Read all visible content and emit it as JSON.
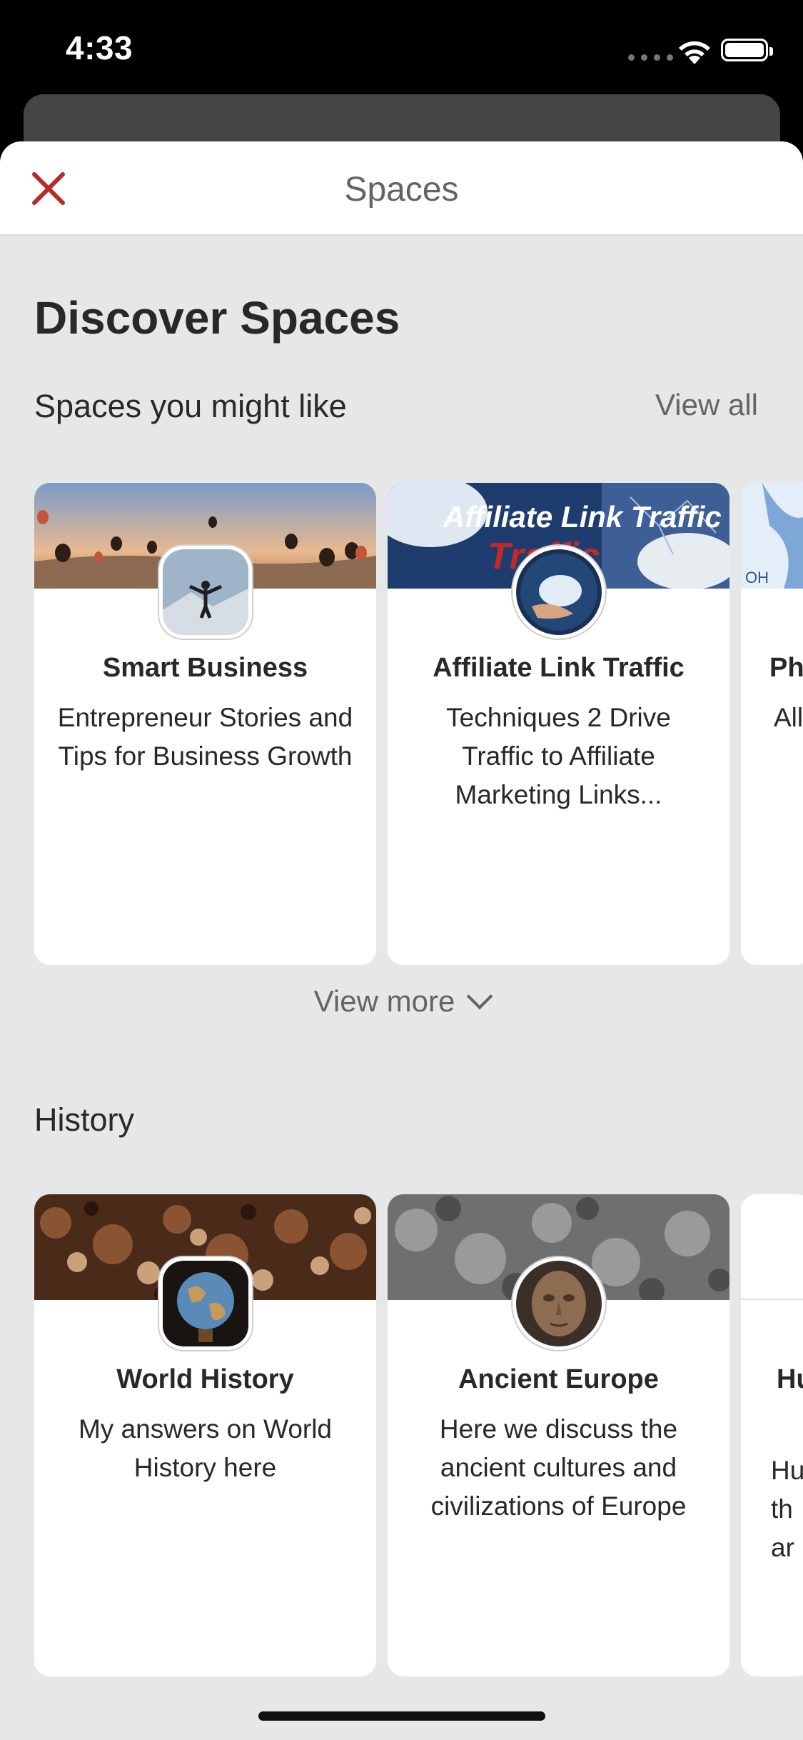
{
  "status_bar": {
    "time": "4:33"
  },
  "header": {
    "title": "Spaces"
  },
  "page": {
    "heading": "Discover Spaces"
  },
  "suggested": {
    "label": "Spaces you might like",
    "view_all": "View all",
    "cards": [
      {
        "title": "Smart Business",
        "description": "Entrepreneur Stories and Tips for Business Growth"
      },
      {
        "title": "Affiliate Link Traffic",
        "description": "Techniques 2 Drive Traffic to Affiliate Marketing Links...",
        "banner_text": "Affiliate Link Traffic"
      },
      {
        "title": "Ph",
        "description": "All"
      }
    ],
    "view_more": "View more"
  },
  "history": {
    "label": "History",
    "cards": [
      {
        "title": "World History",
        "description": "My answers on World History here"
      },
      {
        "title": "Ancient Europe",
        "description": "Here we discuss the ancient cultures and civilizations of Europe"
      },
      {
        "title": "Hu",
        "description": "Hu th ar"
      }
    ]
  },
  "colors": {
    "accent": "#b92b27",
    "background": "#e6e7e9",
    "card": "#ffffff",
    "text": "#282829",
    "muted": "#636466"
  },
  "icons": {
    "close": "close-icon",
    "chevron": "chevron-down-icon",
    "wifi": "wifi-icon",
    "battery": "battery-icon",
    "signal": "signal-icon"
  }
}
